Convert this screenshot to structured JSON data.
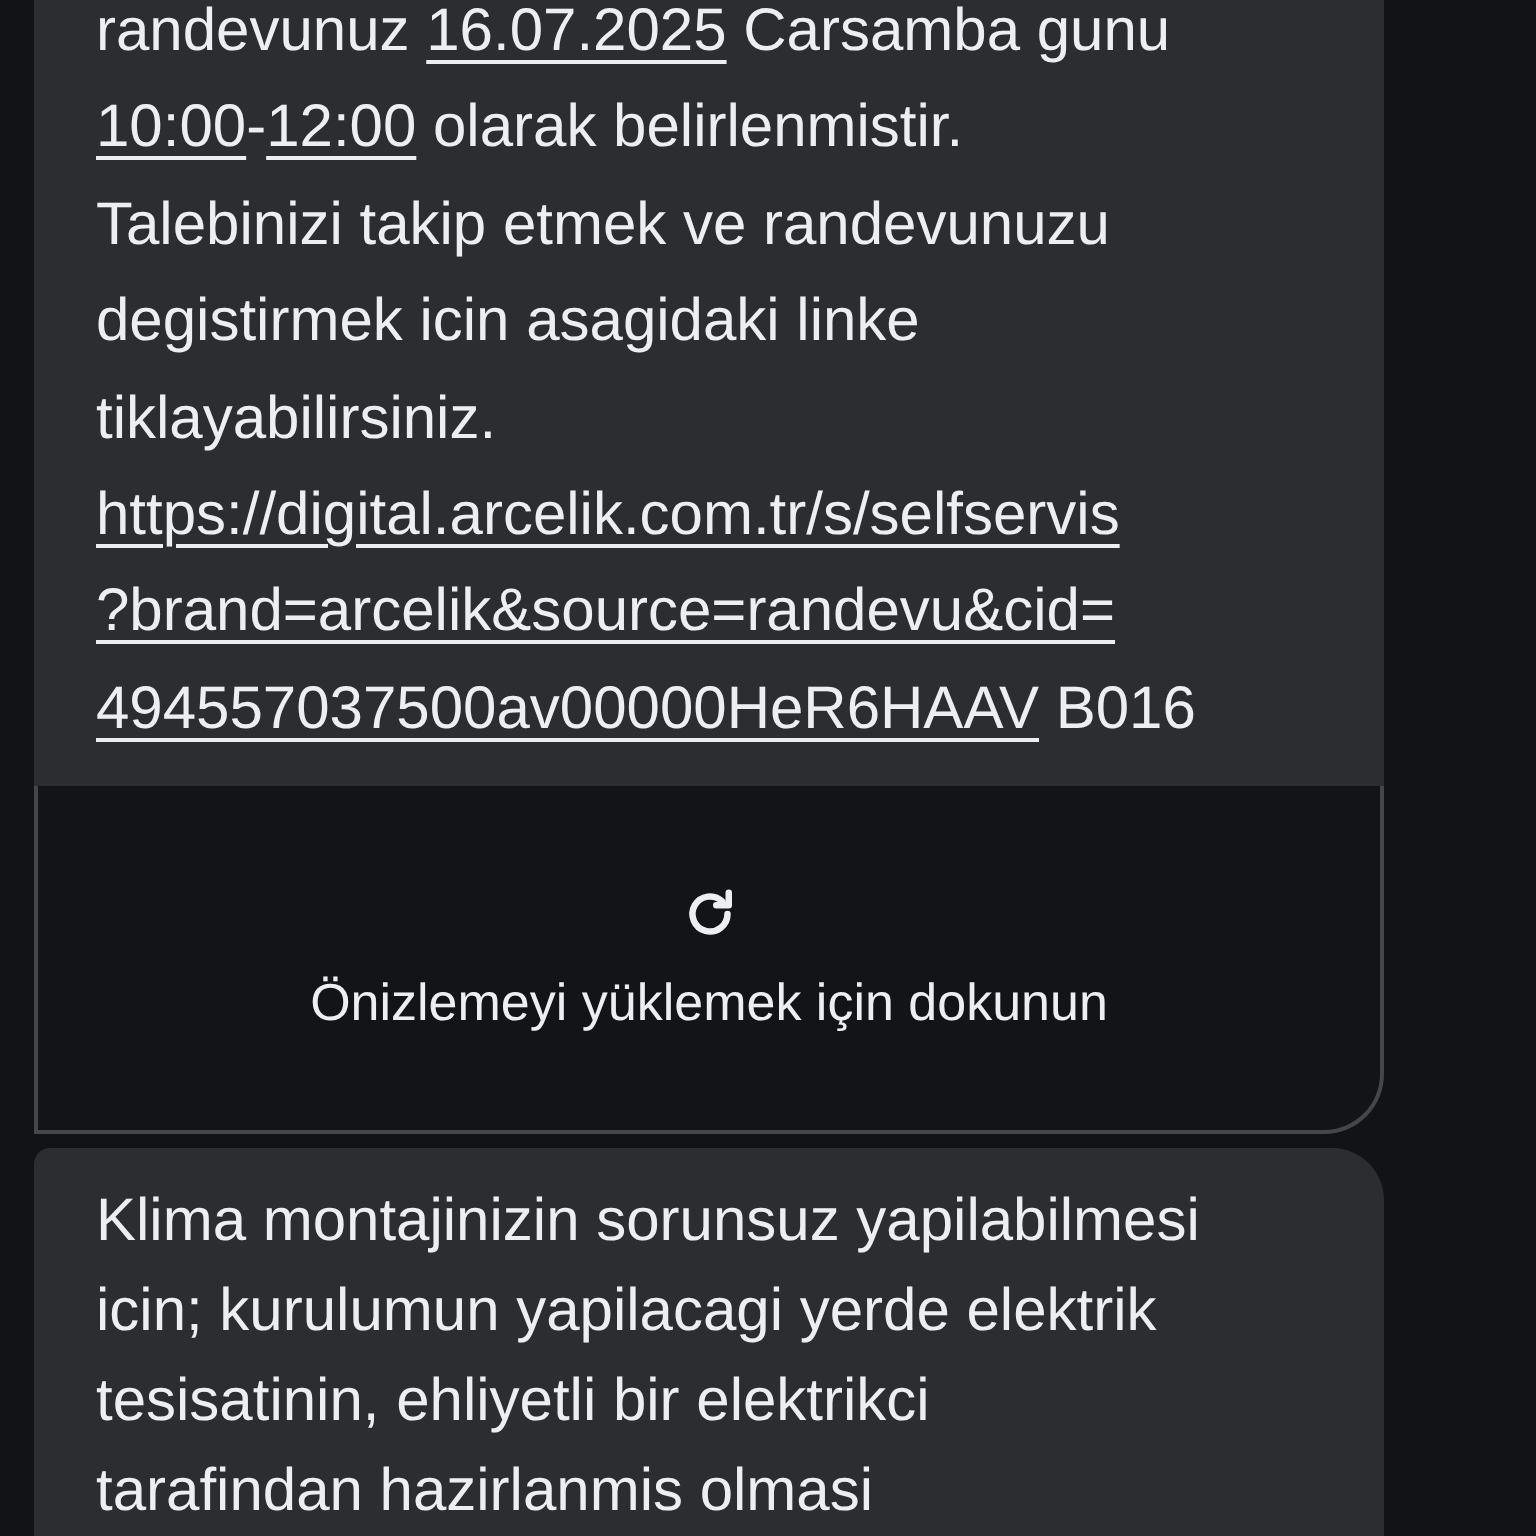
{
  "messages": [
    {
      "kind": "text_with_preview",
      "lines": [
        [
          {
            "text": "randevunuz ",
            "link": false
          },
          {
            "text": "16.07.2025",
            "link": true
          },
          {
            "text": " Carsamba gunu",
            "link": false
          }
        ],
        [
          {
            "text": "10:00",
            "link": true
          },
          {
            "text": "-",
            "link": false
          },
          {
            "text": "12:00",
            "link": true
          },
          {
            "text": " olarak belirlenmistir.",
            "link": false
          }
        ],
        [
          {
            "text": "Talebinizi takip etmek ve randevunuzu",
            "link": false
          }
        ],
        [
          {
            "text": "degistirmek icin asagidaki linke",
            "link": false
          }
        ],
        [
          {
            "text": "tiklayabilirsiniz.",
            "link": false
          }
        ],
        [
          {
            "text": "https://digital.arcelik.com.tr/s/selfservis",
            "link": true
          }
        ],
        [
          {
            "text": "?brand=arcelik&source=randevu&cid=",
            "link": true
          }
        ],
        [
          {
            "text": "494557037500av00000HeR6HAAV",
            "link": true
          },
          {
            "text": " B016",
            "link": false
          }
        ]
      ],
      "preview": {
        "label": "Önizlemeyi yüklemek için dokunun"
      }
    },
    {
      "kind": "text",
      "lines": [
        [
          {
            "text": "Klima montajinizin sorunsuz yapilabilmesi",
            "link": false
          }
        ],
        [
          {
            "text": "icin; kurulumun yapilacagi yerde elektrik",
            "link": false
          }
        ],
        [
          {
            "text": "tesisatinin, ehliyetli bir elektrikci",
            "link": false
          }
        ],
        [
          {
            "text": "tarafindan hazirlanmis olmasi",
            "link": false
          }
        ]
      ]
    }
  ]
}
